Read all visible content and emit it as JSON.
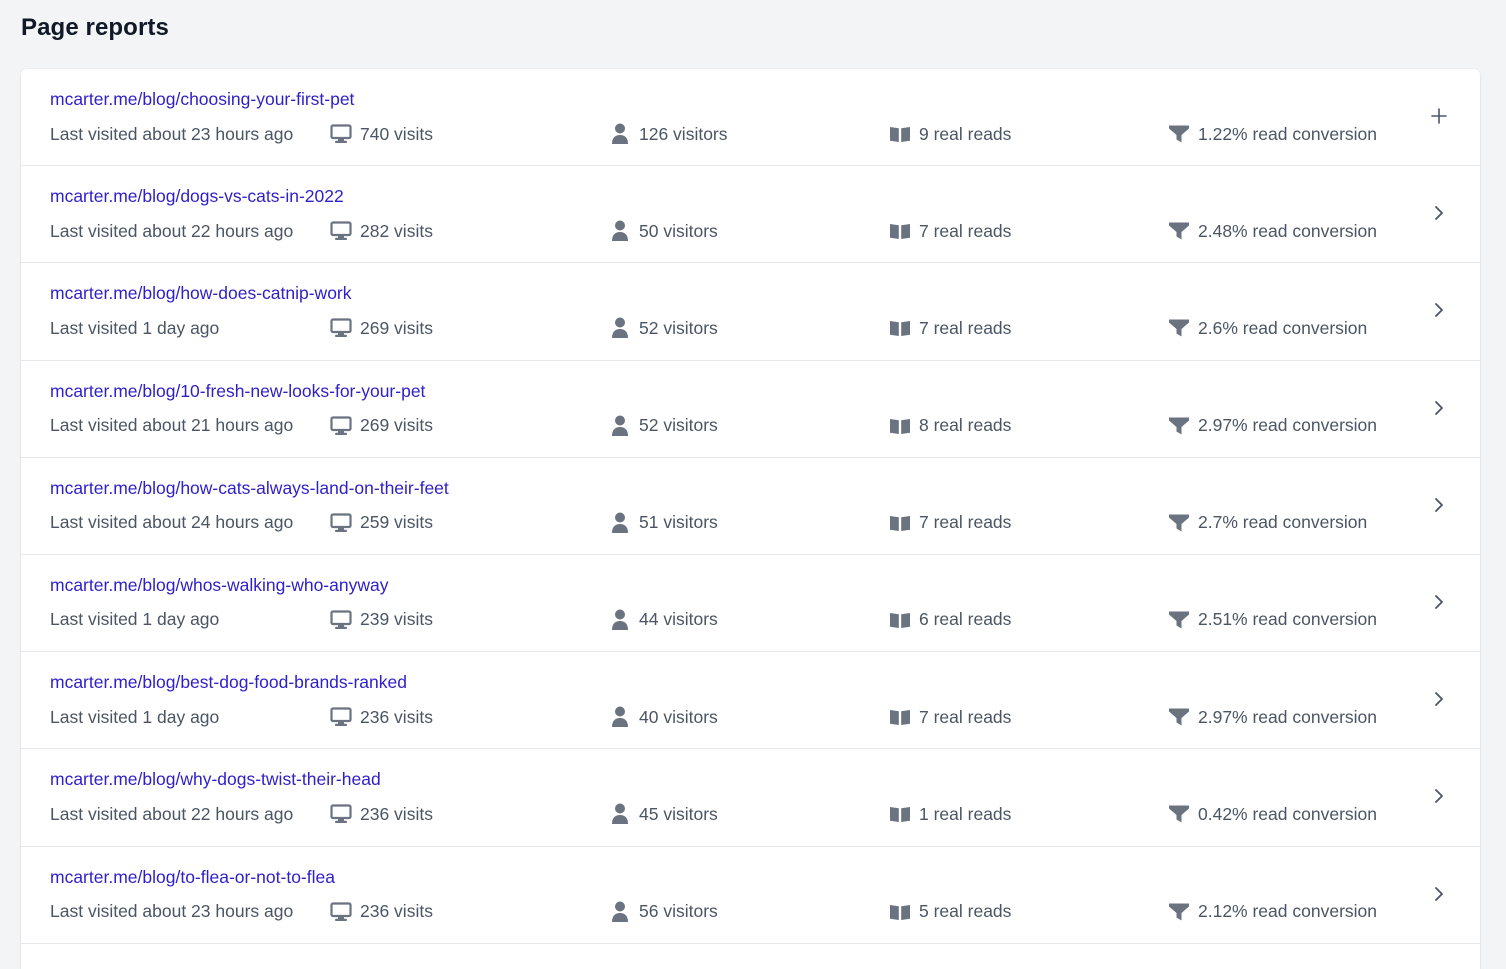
{
  "page": {
    "title": "Page reports"
  },
  "colors": {
    "link": "#2d1fc9",
    "muted_text": "#4b5563",
    "icon": "#6b7280",
    "background": "#f3f4f6",
    "card": "#ffffff",
    "divider": "#e5e7eb"
  },
  "icons": {
    "visits": "monitor-icon",
    "visitors": "user-icon",
    "reads": "book-open-icon",
    "conversion": "funnel-icon",
    "expand": "plus-icon",
    "open": "chevron-right-icon"
  },
  "rows": [
    {
      "url": "mcarter.me/blog/choosing-your-first-pet",
      "last_visited": "Last visited about 23 hours ago",
      "visits": "740 visits",
      "visitors": "126 visitors",
      "reads": "9 real reads",
      "conversion": "1.22% read conversion",
      "action": "plus"
    },
    {
      "url": "mcarter.me/blog/dogs-vs-cats-in-2022",
      "last_visited": "Last visited about 22 hours ago",
      "visits": "282 visits",
      "visitors": "50 visitors",
      "reads": "7 real reads",
      "conversion": "2.48% read conversion",
      "action": "chevron"
    },
    {
      "url": "mcarter.me/blog/how-does-catnip-work",
      "last_visited": "Last visited 1 day ago",
      "visits": "269 visits",
      "visitors": "52 visitors",
      "reads": "7 real reads",
      "conversion": "2.6% read conversion",
      "action": "chevron"
    },
    {
      "url": "mcarter.me/blog/10-fresh-new-looks-for-your-pet",
      "last_visited": "Last visited about 21 hours ago",
      "visits": "269 visits",
      "visitors": "52 visitors",
      "reads": "8 real reads",
      "conversion": "2.97% read conversion",
      "action": "chevron"
    },
    {
      "url": "mcarter.me/blog/how-cats-always-land-on-their-feet",
      "last_visited": "Last visited about 24 hours ago",
      "visits": "259 visits",
      "visitors": "51 visitors",
      "reads": "7 real reads",
      "conversion": "2.7% read conversion",
      "action": "chevron"
    },
    {
      "url": "mcarter.me/blog/whos-walking-who-anyway",
      "last_visited": "Last visited 1 day ago",
      "visits": "239 visits",
      "visitors": "44 visitors",
      "reads": "6 real reads",
      "conversion": "2.51% read conversion",
      "action": "chevron"
    },
    {
      "url": "mcarter.me/blog/best-dog-food-brands-ranked",
      "last_visited": "Last visited 1 day ago",
      "visits": "236 visits",
      "visitors": "40 visitors",
      "reads": "7 real reads",
      "conversion": "2.97% read conversion",
      "action": "chevron"
    },
    {
      "url": "mcarter.me/blog/why-dogs-twist-their-head",
      "last_visited": "Last visited about 22 hours ago",
      "visits": "236 visits",
      "visitors": "45 visitors",
      "reads": "1 real reads",
      "conversion": "0.42% read conversion",
      "action": "chevron"
    },
    {
      "url": "mcarter.me/blog/to-flea-or-not-to-flea",
      "last_visited": "Last visited about 23 hours ago",
      "visits": "236 visits",
      "visitors": "56 visitors",
      "reads": "5 real reads",
      "conversion": "2.12% read conversion",
      "action": "chevron"
    }
  ]
}
